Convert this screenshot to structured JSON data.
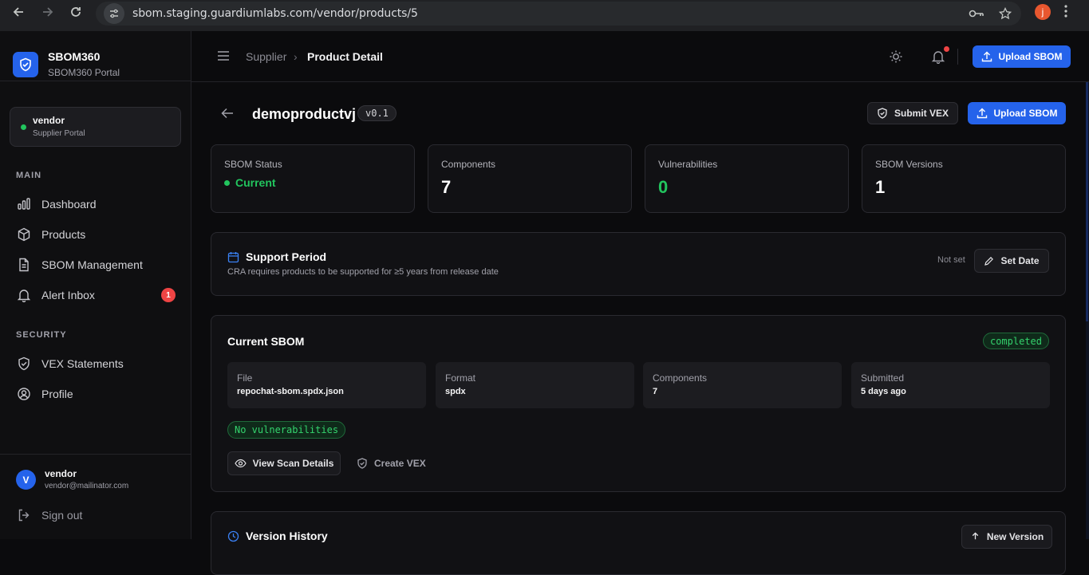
{
  "browser": {
    "url": "sbom.staging.guardiumlabs.com/vendor/products/5",
    "profile_initial": "j"
  },
  "sidebar": {
    "brand_title": "SBOM360",
    "brand_subtitle": "SBOM360 Portal",
    "portal_name": "vendor",
    "portal_role": "Supplier Portal",
    "section_main": "MAIN",
    "section_security": "SECURITY",
    "items": [
      {
        "label": "Dashboard",
        "icon": "bar-chart-icon"
      },
      {
        "label": "Products",
        "icon": "box-icon"
      },
      {
        "label": "SBOM Management",
        "icon": "file-icon"
      },
      {
        "label": "Alert Inbox",
        "icon": "bell-icon",
        "badge": "1"
      },
      {
        "label": "VEX Statements",
        "icon": "shield-check-icon"
      },
      {
        "label": "Profile",
        "icon": "user-circle-icon"
      }
    ],
    "user": {
      "initial": "V",
      "name": "vendor",
      "email": "vendor@mailinator.com"
    },
    "sign_out": "Sign out"
  },
  "topbar": {
    "breadcrumb_parent": "Supplier",
    "breadcrumb_separator": "›",
    "breadcrumb_current": "Product Detail",
    "upload_label": "Upload SBOM"
  },
  "product": {
    "name": "demoproductvj",
    "version": "v0.1",
    "submit_vex_label": "Submit VEX",
    "upload_label": "Upload SBOM"
  },
  "stats": [
    {
      "label": "SBOM Status",
      "value": "Current",
      "color": "#22c55e"
    },
    {
      "label": "Components",
      "value": "7"
    },
    {
      "label": "Vulnerabilities",
      "value": "0",
      "color": "#22c55e"
    },
    {
      "label": "SBOM Versions",
      "value": "1"
    }
  ],
  "support": {
    "title": "Support Period",
    "subtitle": "CRA requires products to be supported for ≥5 years from release date",
    "status": "Not set",
    "set_date_label": "Set Date"
  },
  "current_sbom": {
    "title": "Current SBOM",
    "status_badge": "completed",
    "info": [
      {
        "label": "File",
        "value": "repochat-sbom.spdx.json"
      },
      {
        "label": "Format",
        "value": "spdx"
      },
      {
        "label": "Components",
        "value": "7"
      },
      {
        "label": "Submitted",
        "value": "5 days ago"
      }
    ],
    "vuln_badge": "No vulnerabilities",
    "view_scan_label": "View Scan Details",
    "create_vex_label": "Create VEX"
  },
  "version_history": {
    "title": "Version History",
    "new_version_label": "New Version"
  },
  "colors": {
    "accent": "#2563eb",
    "success": "#22c55e",
    "danger": "#ef4444",
    "background": "#0b0b0d"
  }
}
